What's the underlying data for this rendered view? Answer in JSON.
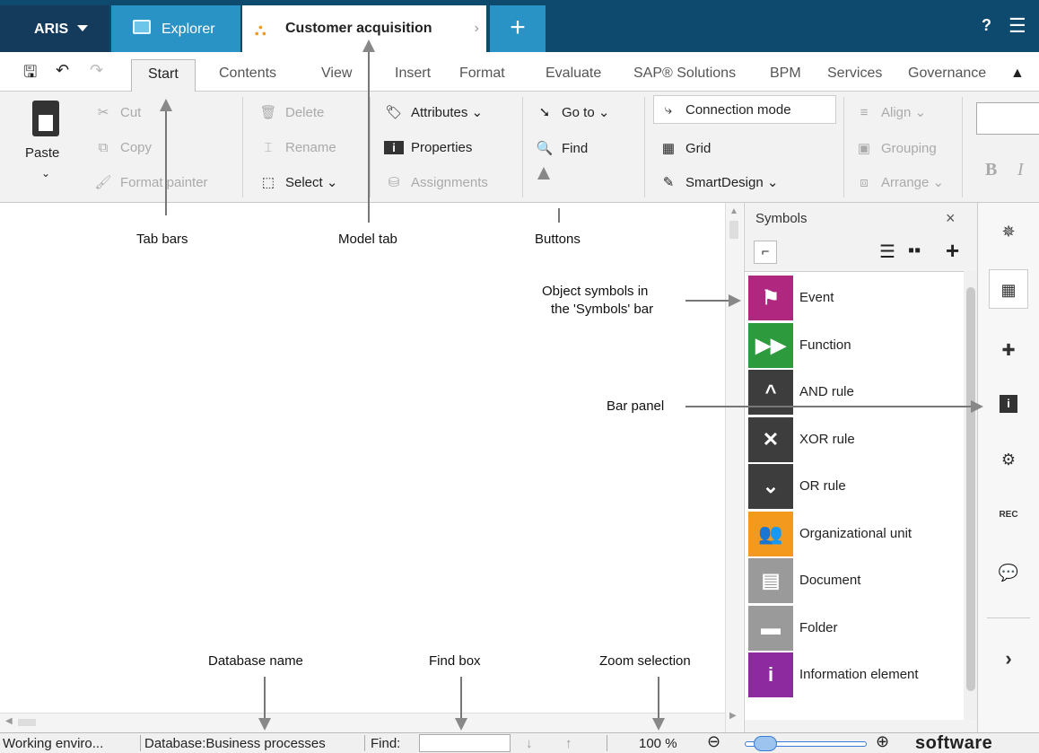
{
  "titlebar": {
    "app": "ARIS",
    "tabs": [
      {
        "label": "Explorer"
      },
      {
        "label": "Customer acquisition"
      }
    ],
    "add": "+",
    "help": "?",
    "menu": "☰"
  },
  "ribbon_tabs": [
    "Start",
    "Contents",
    "View",
    "Insert",
    "Format",
    "Evaluate",
    "SAP® Solutions",
    "BPM",
    "Services",
    "Governance"
  ],
  "ribbon": {
    "paste": "Paste",
    "cut": "Cut",
    "copy": "Copy",
    "format_painter": "Format painter",
    "delete": "Delete",
    "rename": "Rename",
    "select": "Select",
    "attributes": "Attributes",
    "properties": "Properties",
    "assignments": "Assignments",
    "goto": "Go to",
    "find": "Find",
    "connection_mode": "Connection mode",
    "grid": "Grid",
    "smartdesign": "SmartDesign",
    "align": "Align",
    "grouping": "Grouping",
    "arrange": "Arrange",
    "bold": "B",
    "italic": "I"
  },
  "symbols_panel": {
    "title": "Symbols",
    "items": [
      {
        "label": "Event",
        "color": "#b0277f",
        "glyph": "⚑"
      },
      {
        "label": "Function",
        "color": "#2e9a3e",
        "glyph": "▶▶"
      },
      {
        "label": "AND rule",
        "color": "#3d3d3d",
        "glyph": "^"
      },
      {
        "label": "XOR rule",
        "color": "#3d3d3d",
        "glyph": "✕"
      },
      {
        "label": "OR rule",
        "color": "#3d3d3d",
        "glyph": "⌄"
      },
      {
        "label": "Organizational unit",
        "color": "#f39a1e",
        "glyph": "👥"
      },
      {
        "label": "Document",
        "color": "#9a9a9a",
        "glyph": "▤"
      },
      {
        "label": "Folder",
        "color": "#9a9a9a",
        "glyph": "▬"
      },
      {
        "label": "Information element",
        "color": "#8e2aa0",
        "glyph": "i"
      }
    ]
  },
  "status": {
    "environment": "Working enviro...",
    "database": "Database:Business processes",
    "find": "Find:",
    "zoom": "100 %",
    "brand": "software"
  },
  "callouts": {
    "tab_bars": "Tab bars",
    "model_tab": "Model tab",
    "buttons": "Buttons",
    "object_symbols_1": "Object symbols in",
    "object_symbols_2": "the 'Symbols' bar",
    "bar_panel": "Bar panel",
    "database_name": "Database name",
    "find_box": "Find box",
    "zoom_selection": "Zoom selection"
  }
}
